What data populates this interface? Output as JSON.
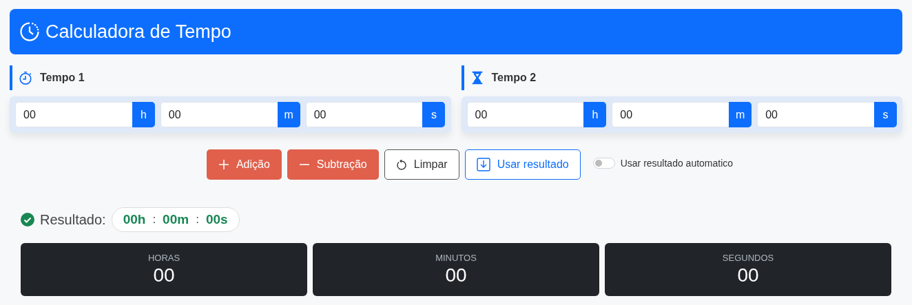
{
  "header": {
    "title": "Calculadora de Tempo"
  },
  "panels": [
    {
      "title": "Tempo 1",
      "kind": "stopwatch",
      "fields": [
        {
          "value": "00",
          "unit": "h"
        },
        {
          "value": "00",
          "unit": "m"
        },
        {
          "value": "00",
          "unit": "s"
        }
      ]
    },
    {
      "title": "Tempo 2",
      "kind": "hourglass",
      "fields": [
        {
          "value": "00",
          "unit": "h"
        },
        {
          "value": "00",
          "unit": "m"
        },
        {
          "value": "00",
          "unit": "s"
        }
      ]
    }
  ],
  "actions": [
    {
      "label": "Adição",
      "kind": "add"
    },
    {
      "label": "Subtração",
      "kind": "subtract"
    },
    {
      "label": "Limpar",
      "kind": "reset"
    },
    {
      "label": "Usar resultado",
      "kind": "use"
    }
  ],
  "auto_toggle": {
    "label": "Usar resultado automatico",
    "on": false
  },
  "result": {
    "label": "Resultado:",
    "parts": [
      "00h",
      "00m",
      "00s"
    ],
    "separators": [
      ":",
      ":"
    ]
  },
  "cards": [
    {
      "label": "HORAS",
      "value": "00"
    },
    {
      "label": "MINUTOS",
      "value": "00"
    },
    {
      "label": "SEGUNDOS",
      "value": "00"
    }
  ]
}
